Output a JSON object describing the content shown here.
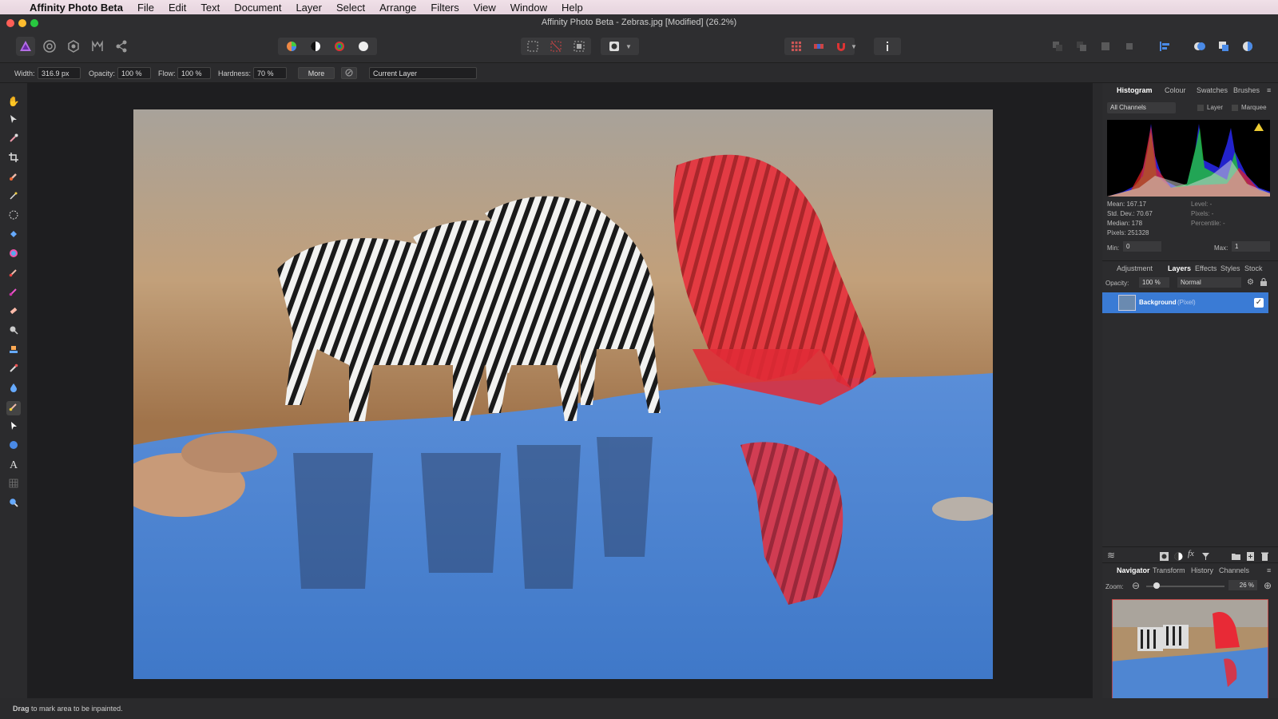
{
  "menubar": {
    "app_name": "Affinity Photo Beta",
    "items": [
      "File",
      "Edit",
      "Text",
      "Document",
      "Layer",
      "Select",
      "Arrange",
      "Filters",
      "View",
      "Window",
      "Help"
    ]
  },
  "window": {
    "title": "Affinity Photo Beta - Zebras.jpg [Modified] (26.2%)"
  },
  "context_toolbar": {
    "width_label": "Width:",
    "width_value": "316.9 px",
    "opacity_label": "Opacity:",
    "opacity_value": "100 %",
    "flow_label": "Flow:",
    "flow_value": "100 %",
    "hardness_label": "Hardness:",
    "hardness_value": "70 %",
    "more_label": "More",
    "layer_select": "Current Layer"
  },
  "histogram_panel": {
    "tabs": [
      "Histogram",
      "Colour",
      "Swatches",
      "Brushes"
    ],
    "channel_select": "All Channels",
    "layer_label": "Layer",
    "marquee_label": "Marquee",
    "mean": "Mean: 167.17",
    "std_dev": "Std. Dev.: 70.67",
    "median": "Median: 178",
    "pixels": "Pixels: 251328",
    "level": "Level: -",
    "pixels_right": "Pixels: -",
    "percentile": "Percentile: -",
    "min_label": "Min:",
    "min_value": "0",
    "max_label": "Max:",
    "max_value": "1"
  },
  "layers_panel": {
    "tabs": [
      "Adjustment",
      "Layers",
      "Effects",
      "Styles",
      "Stock"
    ],
    "opacity_label": "Opacity:",
    "opacity_value": "100 %",
    "blend_mode": "Normal",
    "layer_name": "Background",
    "layer_type": "(Pixel)"
  },
  "navigator_panel": {
    "tabs": [
      "Navigator",
      "Transform",
      "History",
      "Channels"
    ],
    "zoom_label": "Zoom:",
    "zoom_value": "26 %"
  },
  "status": {
    "bold": "Drag",
    "text": " to mark area to be inpainted."
  },
  "colors": {
    "accent": "#3a7bd5",
    "selection_red": "#e8202e",
    "traffic_close": "#ff5f57",
    "traffic_min": "#febc2e",
    "traffic_max": "#28c840"
  }
}
